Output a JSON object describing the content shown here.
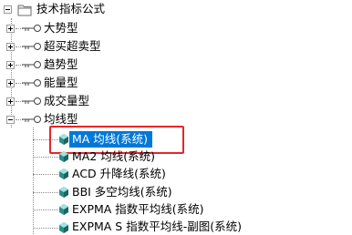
{
  "tree": {
    "root": {
      "label": "技术指标公式",
      "expanded": true,
      "icon": "folder-icon"
    },
    "categories": [
      {
        "label": "大势型",
        "expanded": false
      },
      {
        "label": "超买超卖型",
        "expanded": false
      },
      {
        "label": "趋势型",
        "expanded": false
      },
      {
        "label": "能量型",
        "expanded": false
      },
      {
        "label": "成交量型",
        "expanded": false
      },
      {
        "label": "均线型",
        "expanded": true
      }
    ],
    "formulas": [
      {
        "label": "MA  均线(系统)",
        "selected": true
      },
      {
        "label": "MA2  均线(系统)",
        "selected": false
      },
      {
        "label": "ACD  升降线(系统)",
        "selected": false
      },
      {
        "label": "BBI  多空均线(系统)",
        "selected": false
      },
      {
        "label": "EXPMA  指数平均线(系统)",
        "selected": false
      },
      {
        "label": "EXPMA S  指数平均线-副图(系统)",
        "selected": false
      }
    ]
  },
  "colors": {
    "selection": "#0078d7",
    "highlight_box": "#e4262b",
    "formula_icon": "#2a8d8a"
  }
}
